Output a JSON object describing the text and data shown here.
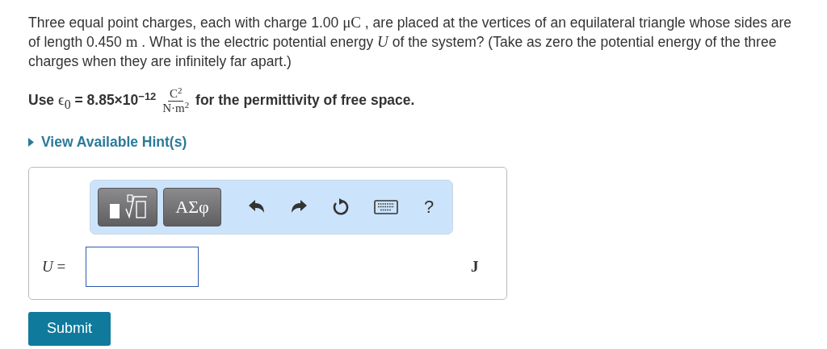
{
  "problem": [
    {
      "kind": "text",
      "text": "Three equal point charges, each with charge 1.00 "
    },
    {
      "kind": "math",
      "text": "μC"
    },
    {
      "kind": "text",
      "text": " , are placed at the vertices of an equilateral triangle whose sides are of length 0.450 "
    },
    {
      "kind": "math",
      "text": "m"
    },
    {
      "kind": "text",
      "text": " . What is the electric potential energy "
    },
    {
      "kind": "math",
      "text": "*U*"
    },
    {
      "kind": "text",
      "text": " of the system? (Take as zero the potential energy of the three charges when they are infinitely far apart.)"
    }
  ],
  "constant": {
    "before": "Use",
    "symbol": "ϵ$_{0}$",
    "value": "= 8.85×10$^{−12}$",
    "numerator": "C$^{2}$",
    "denominator": "N·m$^{2}$",
    "after": "for the permittivity of free space."
  },
  "hint_link": "View Available Hint(s)",
  "toolbar": [
    {
      "kind": "templates"
    },
    {
      "kind": "greek",
      "text": "ΑΣφ"
    },
    {
      "kind": "undo"
    },
    {
      "kind": "redo"
    },
    {
      "kind": "reset"
    },
    {
      "kind": "keyboard"
    },
    {
      "kind": "help",
      "text": "?"
    }
  ],
  "answer": {
    "label": "*U* =",
    "unit": "J"
  },
  "submit": "Submit"
}
